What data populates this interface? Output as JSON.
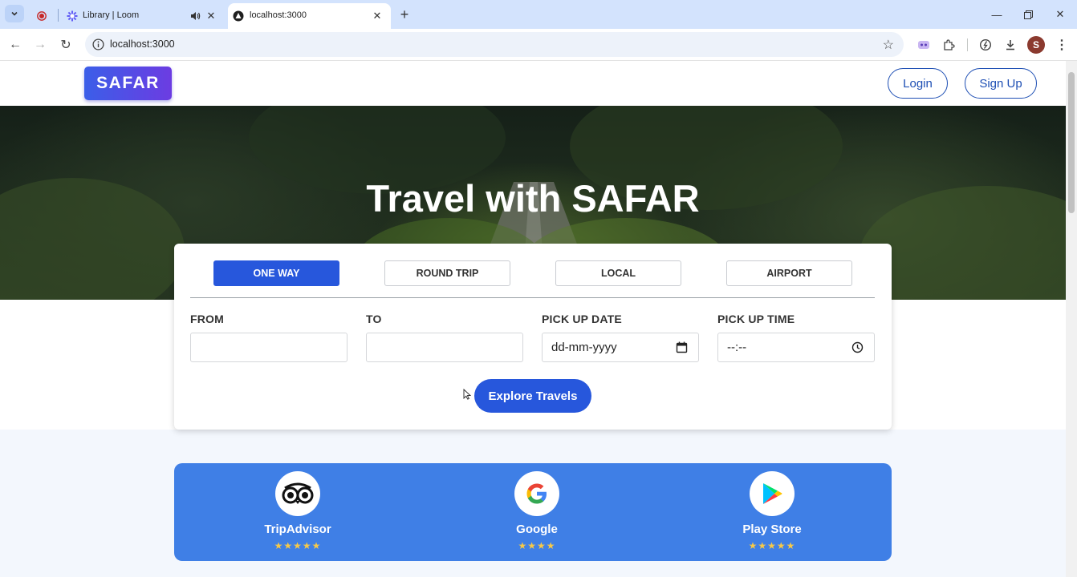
{
  "browser": {
    "tabs": [
      {
        "title": ""
      },
      {
        "title": "Library | Loom"
      },
      {
        "title": "localhost:3000"
      }
    ],
    "url": "localhost:3000",
    "profile_initial": "S"
  },
  "header": {
    "logo": "SAFAR",
    "login_label": "Login",
    "signup_label": "Sign Up"
  },
  "hero": {
    "title": "Travel with SAFAR"
  },
  "booking": {
    "trip_tabs": [
      {
        "label": "ONE WAY",
        "active": true
      },
      {
        "label": "ROUND TRIP",
        "active": false
      },
      {
        "label": "LOCAL",
        "active": false
      },
      {
        "label": "AIRPORT",
        "active": false
      }
    ],
    "fields": [
      {
        "label": "FROM",
        "value": ""
      },
      {
        "label": "TO",
        "value": ""
      },
      {
        "label": "PICK UP DATE",
        "value": "dd-mm-yyyy",
        "icon": "calendar-icon"
      },
      {
        "label": "PICK UP TIME",
        "value": "--:--",
        "icon": "clock-icon"
      }
    ],
    "submit_label": "Explore Travels"
  },
  "ratings": [
    {
      "name": "TripAdvisor",
      "stars": "★★★★★",
      "icon": "tripadvisor-icon"
    },
    {
      "name": "Google",
      "stars": "★★★★",
      "icon": "google-icon"
    },
    {
      "name": "Play Store",
      "stars": "★★★★★",
      "icon": "play-store-icon"
    }
  ],
  "colors": {
    "primary": "#2757dc",
    "ratings_bg": "#3f7fe6",
    "star": "#f7c948",
    "tab_strip": "#d3e3fd"
  }
}
